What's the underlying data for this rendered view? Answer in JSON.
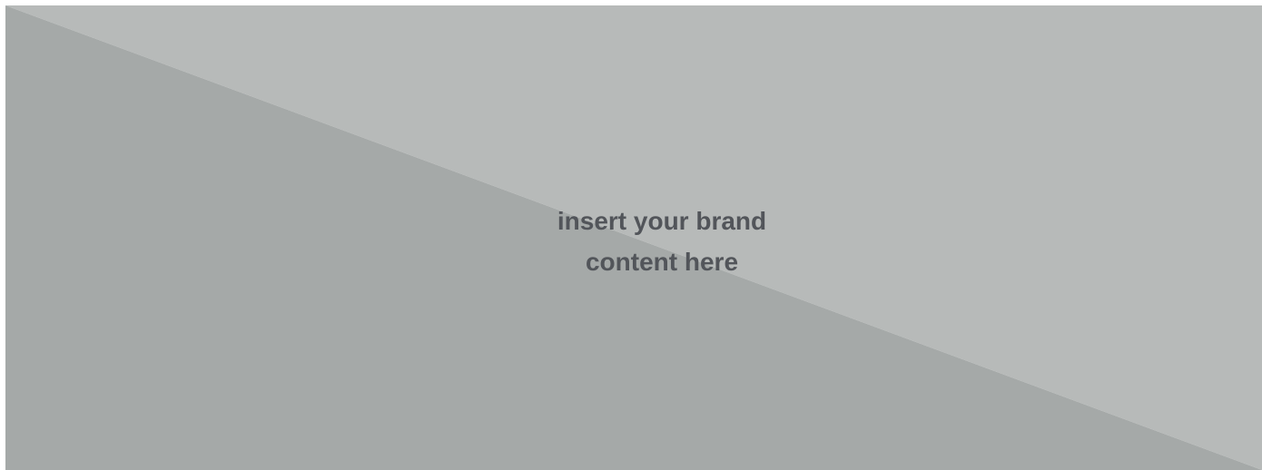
{
  "banner": {
    "caption_lines": [
      "insert your brand",
      "content here"
    ],
    "colors": {
      "upper_triangle": "#b7bab9",
      "lower_triangle": "#a5a9a8",
      "text": "#52555a",
      "page_background": "#ffffff"
    }
  }
}
